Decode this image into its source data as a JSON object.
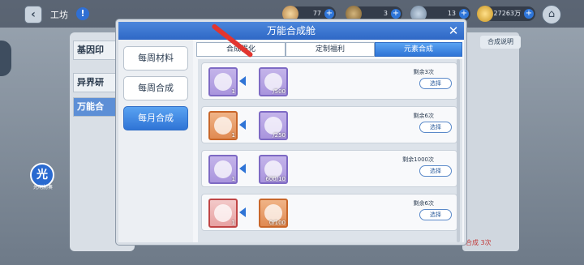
{
  "header": {
    "back_icon": "back-arrow-icon",
    "title": "工坊",
    "info_icon": "info-icon",
    "resources": [
      {
        "icon": "feather-icon",
        "value": "77"
      },
      {
        "icon": "monster-token-icon",
        "value": "3"
      },
      {
        "icon": "medal-icon",
        "value": "13"
      },
      {
        "icon": "gold-coin-icon",
        "value": "27263万"
      }
    ],
    "home_icon": "home-icon"
  },
  "background": {
    "tabs": [
      "基因印",
      "异界研",
      "万能合"
    ],
    "right_button": "合成说明",
    "footer_text": "素合成 3次",
    "light_button_glyph": "光",
    "light_button_caption": "光明前奏"
  },
  "dialog": {
    "title": "万能合成舱",
    "close_glyph": "✕",
    "left_tabs": [
      "每周材料",
      "每周合成",
      "每月合成"
    ],
    "left_selected": 2,
    "sub_tabs": [
      "合成强化",
      "定制福利",
      "元素合成"
    ],
    "sub_selected": 2,
    "rows": [
      {
        "output_rarity": "purple",
        "output_count": "1",
        "output_icon": "ring-icon",
        "input_rarity": "purple",
        "input_amount": "/500",
        "input_icon": "crystal-icon",
        "remain": "剩余3次",
        "button": "选择"
      },
      {
        "output_rarity": "orange",
        "output_count": "1",
        "output_icon": "bottle-icon",
        "input_rarity": "purple",
        "input_amount": "/250",
        "input_icon": "crystal-icon",
        "remain": "剩余6次",
        "button": "选择"
      },
      {
        "output_rarity": "purple",
        "output_count": "1",
        "output_icon": "fish-icon",
        "input_rarity": "purple",
        "input_amount": "600/10",
        "input_icon": "crystal-icon",
        "remain": "剩余1000次",
        "button": "选择"
      },
      {
        "output_rarity": "red",
        "output_count": "1",
        "output_icon": "crystal-shard-icon",
        "input_rarity": "orange",
        "input_amount": "0/100",
        "input_icon": "gem-icon",
        "remain": "剩余6次",
        "button": "选择"
      }
    ]
  },
  "colors": {
    "accent_blue": "#2f74d6",
    "annotation_red": "#e2352f"
  }
}
